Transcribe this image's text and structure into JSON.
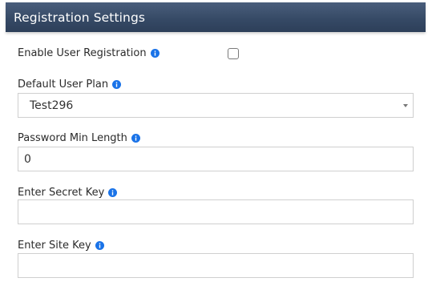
{
  "panel": {
    "title": "Registration Settings"
  },
  "fields": {
    "enable_registration": {
      "label": "Enable User Registration",
      "checked": false
    },
    "default_plan": {
      "label": "Default User Plan",
      "value": "Test296"
    },
    "password_min_length": {
      "label": "Password Min Length",
      "value": "0"
    },
    "secret_key": {
      "label": "Enter Secret Key",
      "value": ""
    },
    "site_key": {
      "label": "Enter Site Key",
      "value": ""
    }
  },
  "icons": {
    "info": "info-icon",
    "dropdown": "chevron-down-icon"
  },
  "colors": {
    "header_bg": "#364a66",
    "info_icon": "#1a73e8"
  }
}
